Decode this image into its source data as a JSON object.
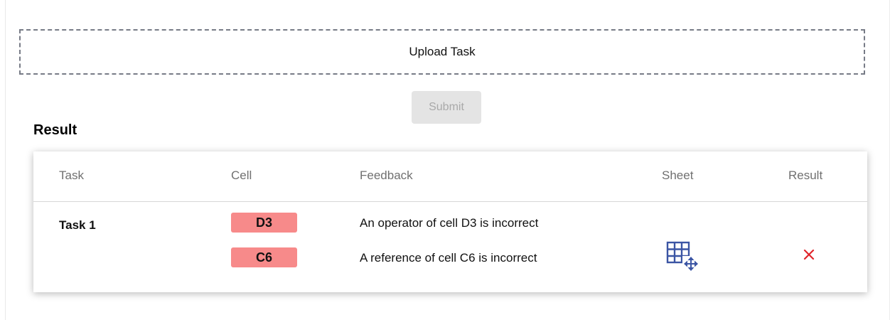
{
  "upload": {
    "label": "Upload Task"
  },
  "submit": {
    "label": "Submit"
  },
  "result": {
    "title": "Result",
    "columns": [
      "Task",
      "Cell",
      "Feedback",
      "Sheet",
      "Result"
    ],
    "rows": [
      {
        "task": "Task 1",
        "items": [
          {
            "cell": "D3",
            "feedback": "An operator of cell D3 is incorrect"
          },
          {
            "cell": "C6",
            "feedback": "A reference of cell C6 is incorrect"
          }
        ],
        "sheet_icon": "spreadsheet-move-icon",
        "result_icon": "close-icon"
      }
    ]
  },
  "colors": {
    "badge": "#f78a8a",
    "result_cross": "#e0242a",
    "sheet_icon": "#3b55a4",
    "upload_border": "#777b86",
    "submit_bg": "#e4e4e4",
    "submit_text": "#a9a9a9"
  }
}
